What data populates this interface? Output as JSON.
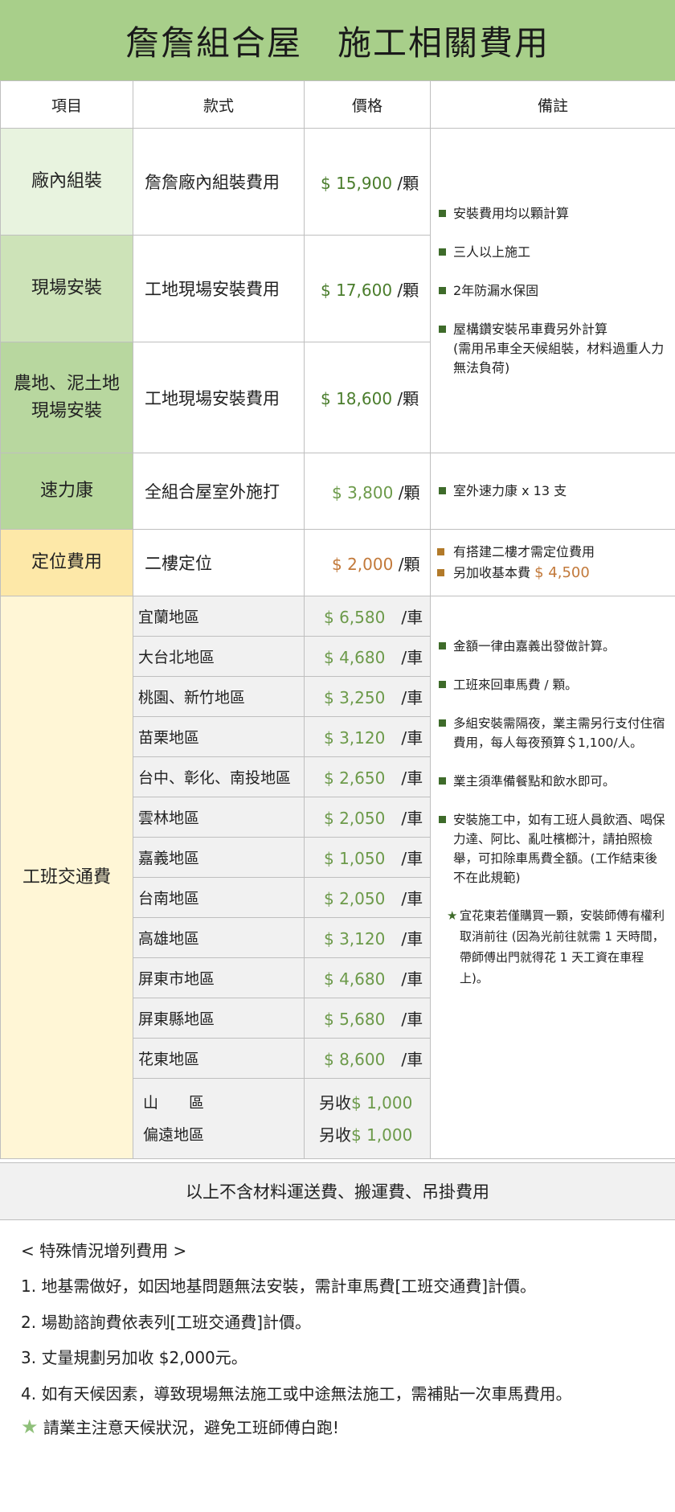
{
  "title": "詹詹組合屋　施工相關費用",
  "headers": {
    "item": "項目",
    "style": "款式",
    "price": "價格",
    "notes": "備註"
  },
  "rows": {
    "factory": {
      "item": "廠內組裝",
      "style": "詹詹廠內組裝費用",
      "price": "$ 15,900",
      "unit": "/顆"
    },
    "onsite": {
      "item": "現場安裝",
      "style": "工地現場安裝費用",
      "price": "$ 17,600",
      "unit": "/顆"
    },
    "farm": {
      "item_line1": "農地、泥土地",
      "item_line2": "現場安裝",
      "style": "工地現場安裝費用",
      "price": "$ 18,600",
      "unit": "/顆"
    },
    "silicone": {
      "item": "速力康",
      "style": "全組合屋室外施打",
      "price": "$ 3,800",
      "unit": "/顆",
      "note": "室外速力康 x 13 支"
    },
    "positioning": {
      "item": "定位費用",
      "style": "二樓定位",
      "price": "$ 2,000",
      "unit": "/顆",
      "note1": "有搭建二樓才需定位費用",
      "note2_prefix": "另加收基本費",
      "note2_amount": "$ 4,500"
    }
  },
  "install_notes": [
    "安裝費用均以顆計算",
    "三人以上施工",
    "2年防漏水保固",
    "屋構鑽安裝吊車費另外計算",
    "(需用吊車全天候組裝，材料過重人力無法負荷)"
  ],
  "travel": {
    "item": "工班交通費",
    "unit": "/車",
    "areas": [
      {
        "name": "宜蘭地區",
        "price": "$ 6,580"
      },
      {
        "name": "大台北地區",
        "price": "$ 4,680"
      },
      {
        "name": "桃園、新竹地區",
        "price": "$ 3,250"
      },
      {
        "name": "苗栗地區",
        "price": "$ 3,120"
      },
      {
        "name": "台中、彰化、南投地區",
        "price": "$ 2,650"
      },
      {
        "name": "雲林地區",
        "price": "$ 2,050"
      },
      {
        "name": "嘉義地區",
        "price": "$ 1,050"
      },
      {
        "name": "台南地區",
        "price": "$ 2,050"
      },
      {
        "name": "高雄地區",
        "price": "$ 3,120"
      },
      {
        "name": "屏東市地區",
        "price": "$ 4,680"
      },
      {
        "name": "屏東縣地區",
        "price": "$ 5,680"
      },
      {
        "name": "花東地區",
        "price": "$ 8,600"
      }
    ],
    "extra": [
      {
        "name": "山　　區",
        "prefix": "另收",
        "price": "$ 1,000"
      },
      {
        "name": "偏遠地區",
        "prefix": "另收",
        "price": "$ 1,000"
      }
    ],
    "notes": [
      "金額一律由嘉義出發做計算。",
      "工班來回車馬費 / 顆。",
      "多組安裝需隔夜，業主需另行支付住宿費用，每人每夜預算＄1,100/人。",
      "業主須準備餐點和飲水即可。",
      "安裝施工中，如有工班人員飲酒、喝保力達、阿比、亂吐檳榔汁，請拍照檢舉，可扣除車馬費全額。(工作結束後不在此規範)"
    ],
    "star_note": "宜花東若僅購買一顆，安裝師傅有權利取消前往 (因為光前往就需 1 天時間，帶師傅出門就得花 1 天工資在車程上)。"
  },
  "footer": "以上不含材料運送費、搬運費、吊掛費用",
  "special": {
    "heading": "< 特殊情況增列費用 >",
    "items": [
      "1.  地基需做好，如因地基問題無法安裝，需計車馬費[工班交通費]計價。",
      "2. 場勘諮詢費依表列[工班交通費]計價。",
      "3. 丈量規劃另加收 $2,000元。",
      "4. 如有天候因素，導致現場無法施工或中途無法施工，需補貼一次車馬費用。"
    ],
    "reminder": "請業主注意天候狀況，避免工班師傅白跑!"
  },
  "colors": {
    "title_bg": "#a8cf8a",
    "price_green": "#4a7d2c",
    "price_orange": "#c2793a"
  }
}
